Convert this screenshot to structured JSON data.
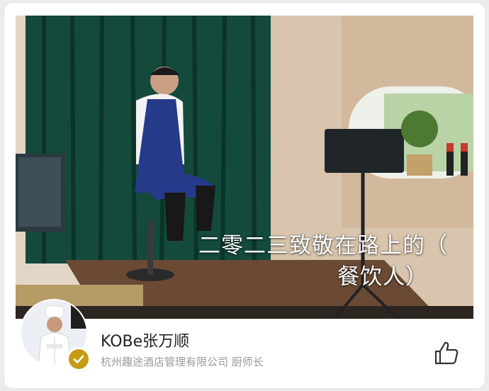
{
  "video": {
    "subtitle_line1": "二零二三致敬在路上的（",
    "subtitle_line2": "餐饮人）"
  },
  "author": {
    "name": "KOBe张万顺",
    "company_title": "杭州趣途酒店管理有限公司 厨师长",
    "verified_icon": "check-badge-icon",
    "like_icon": "thumbs-up-icon"
  },
  "colors": {
    "badge": "#c79a14",
    "name_text": "#222222",
    "meta_text": "#9a9a9a"
  }
}
